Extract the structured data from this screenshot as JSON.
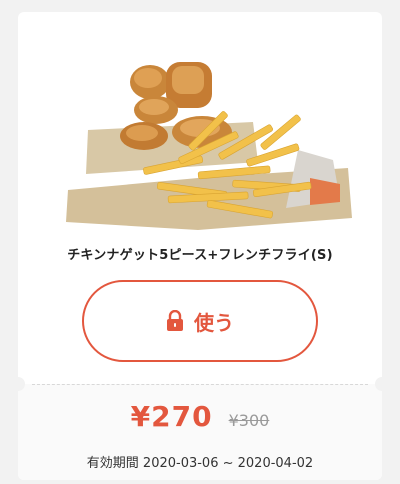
{
  "coupon": {
    "product_name": "チキンナゲット5ピース+フレンチフライ(S)",
    "use_button": {
      "icon": "lock-icon",
      "label": "使う"
    },
    "price": "¥270",
    "original_price": "¥300",
    "validity": "有効期間 2020-03-06 ~ 2020-04-02"
  },
  "colors": {
    "accent": "#e3573e",
    "card": "#ffffff",
    "background": "#f2f2f2",
    "muted_text": "#9a9a9a"
  }
}
